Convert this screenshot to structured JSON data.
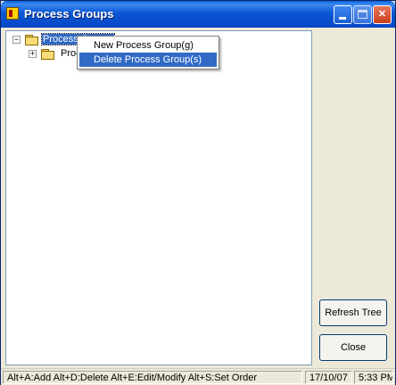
{
  "window": {
    "title": "Process Groups"
  },
  "tree": {
    "root_label": "Process Groups",
    "child_label": "Process Group",
    "root_expander": "−",
    "child_expander": "+"
  },
  "context_menu": {
    "items": [
      {
        "label": "New Process Group(g)"
      },
      {
        "label": "Delete Process Group(s)"
      }
    ]
  },
  "buttons": {
    "refresh_label": "Refresh Tree",
    "close_label": "Close"
  },
  "statusbar": {
    "shortcuts": "Alt+A:Add   Alt+D:Delete   Alt+E:Edit/Modify   Alt+S:Set Order",
    "date": "17/10/07",
    "time": "5:33 PM"
  },
  "colors": {
    "title_bar": "#0a57d6",
    "selection": "#316ac5",
    "window_bg": "#ece9d8"
  }
}
